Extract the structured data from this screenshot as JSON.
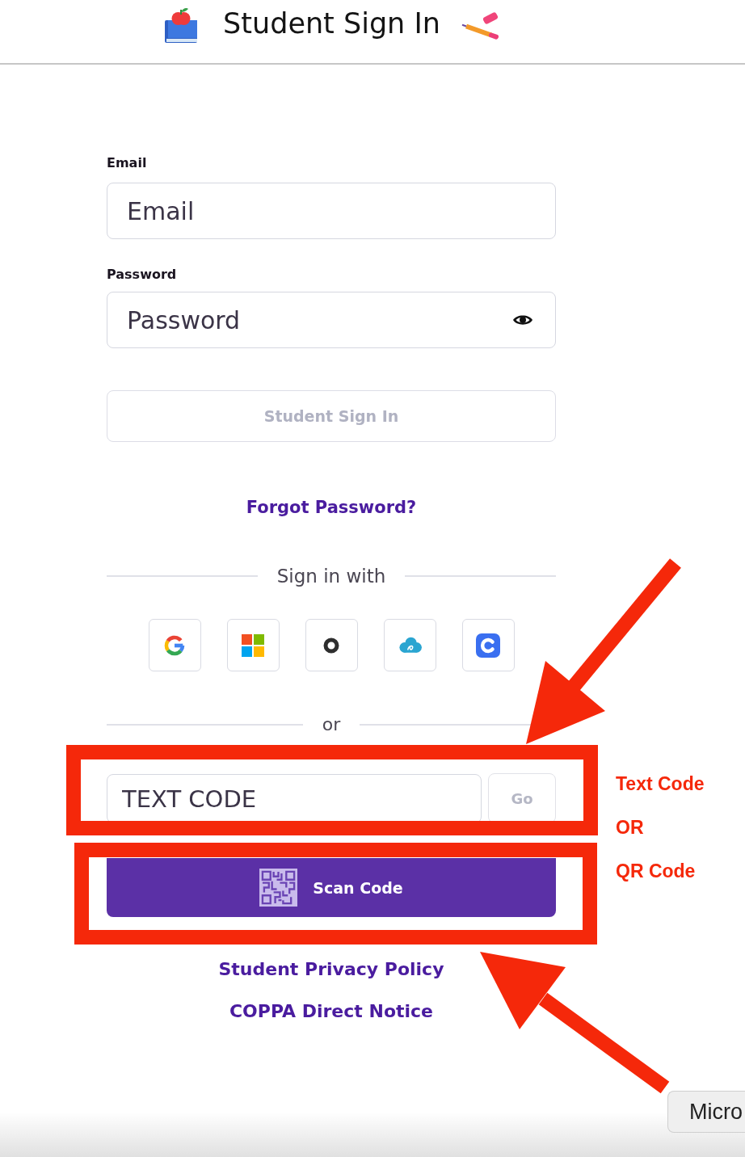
{
  "header": {
    "title": "Student Sign In"
  },
  "form": {
    "email": {
      "label": "Email",
      "placeholder": "Email"
    },
    "password": {
      "label": "Password",
      "placeholder": "Password"
    },
    "submit": {
      "label": "Student Sign In",
      "disabled": true
    },
    "forgot_link": "Forgot Password?",
    "sso_divider": "Sign in with",
    "or_divider": "or",
    "code": {
      "placeholder": "TEXT CODE"
    },
    "go_button": {
      "label": "Go",
      "disabled": true
    },
    "scan_button": "Scan Code",
    "links": [
      "Student Privacy Policy",
      "COPPA Direct Notice"
    ]
  },
  "annotations": {
    "labels": [
      "Text Code",
      "OR",
      "QR Code"
    ]
  },
  "corner_button": "Micro"
}
